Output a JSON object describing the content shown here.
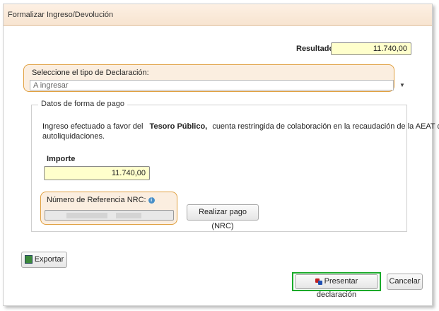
{
  "window": {
    "title": "Formalizar Ingreso/Devolución"
  },
  "resultado": {
    "label": "Resultado",
    "value": "11.740,00"
  },
  "declaracion": {
    "label": "Seleccione el tipo de Declaración:",
    "selected": "A ingresar"
  },
  "pago": {
    "legend": "Datos de forma de pago",
    "text_before": "Ingreso efectuado a favor del",
    "text_bold": "Tesoro Público,",
    "text_after": "cuenta restringida de colaboración en la recaudación de la AEAT de",
    "text_line2": "autoliquidaciones.",
    "importe_label": "Importe",
    "importe_value": "11.740,00",
    "nrc_label": "Número de Referencia NRC:",
    "nrc_info_icon": "info-icon",
    "realizar_label": "Realizar pago (NRC)"
  },
  "buttons": {
    "exportar": "Exportar",
    "presentar": "Presentar declaración",
    "cancelar": "Cancelar"
  },
  "colors": {
    "highlight_orange": "#e0a040",
    "highlight_green": "#1aaa2a",
    "field_yellow": "#ffffcc",
    "title_bg": "#fbe9d6"
  }
}
